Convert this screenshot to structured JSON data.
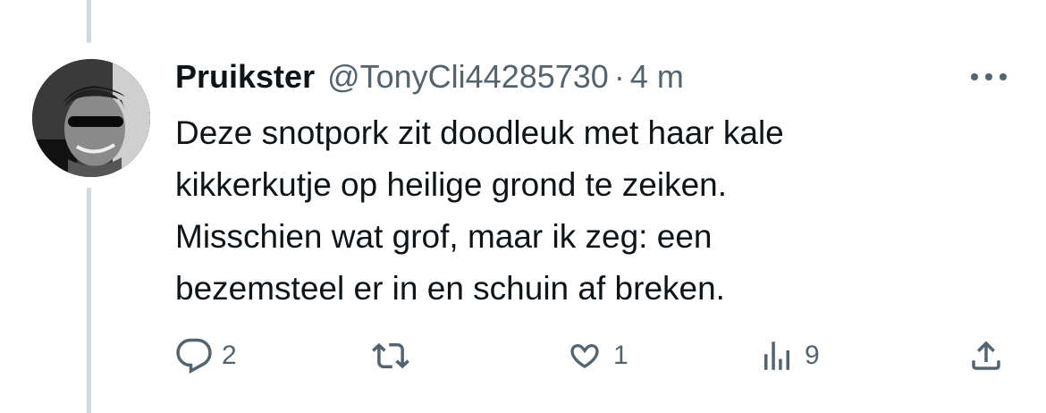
{
  "tweet": {
    "author": {
      "display_name": "Pruikster",
      "handle": "@TonyCli44285730"
    },
    "separator": "·",
    "timestamp": "4 m",
    "text_lines": [
      "Deze snotpork zit doodleuk met haar kale",
      "kikkerkutje op heilige grond te zeiken.",
      "Misschien wat grof, maar ik zeg: een",
      "bezemsteel er in en schuin af breken."
    ],
    "actions": {
      "reply": {
        "icon": "reply-icon",
        "count": "2"
      },
      "retweet": {
        "icon": "retweet-icon",
        "count": ""
      },
      "like": {
        "icon": "heart-icon",
        "count": "1"
      },
      "views": {
        "icon": "views-icon",
        "count": "9"
      },
      "share": {
        "icon": "share-icon"
      }
    },
    "colors": {
      "text": "#0f1419",
      "secondary": "#536471",
      "thread_line": "#cfd9de",
      "background": "#ffffff"
    }
  }
}
